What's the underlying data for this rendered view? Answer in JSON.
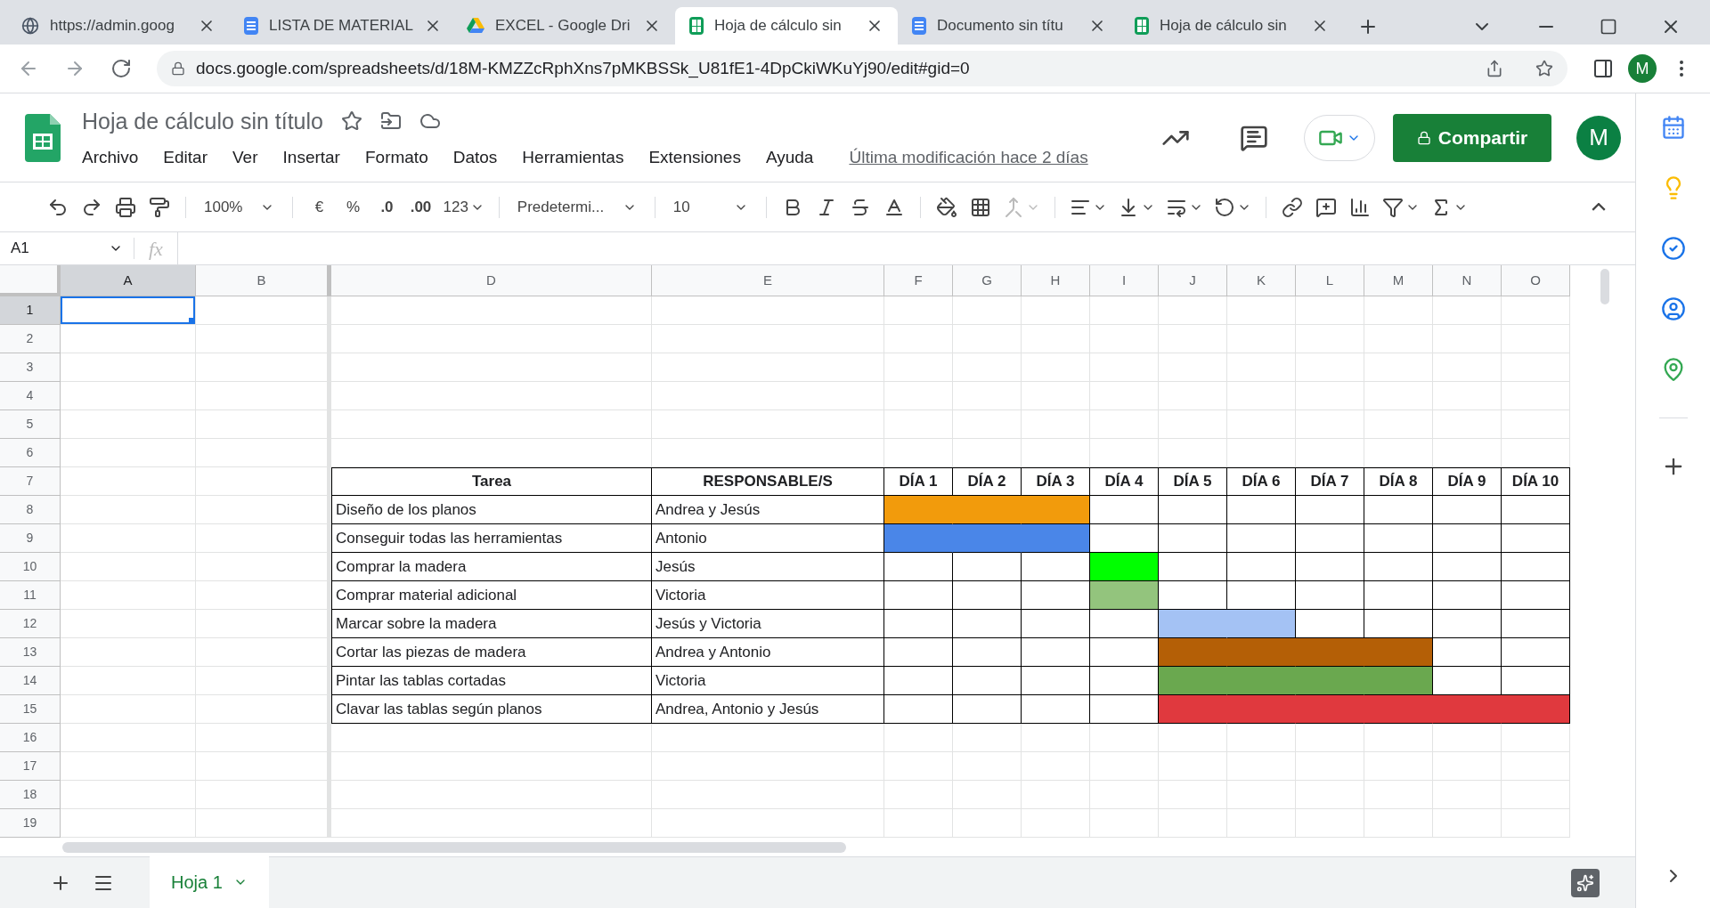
{
  "browser_tabs": [
    {
      "title": "https://admin.goog",
      "kind": "globe",
      "selected": false
    },
    {
      "title": "LISTA DE MATERIAL",
      "kind": "docs",
      "selected": false
    },
    {
      "title": "EXCEL - Google Dri",
      "kind": "drive",
      "selected": false
    },
    {
      "title": "Hoja de cálculo sin",
      "kind": "sheets",
      "selected": true
    },
    {
      "title": "Documento sin títu",
      "kind": "docs",
      "selected": false
    },
    {
      "title": "Hoja de cálculo sin",
      "kind": "sheets",
      "selected": false
    }
  ],
  "address_bar": {
    "url": "docs.google.com/spreadsheets/d/18M-KMZZcRphXns7pMKBSSk_U81fE1-4DpCkiWKuYj90/edit#gid=0",
    "profile": "M"
  },
  "document": {
    "title": "Hoja de cálculo sin título",
    "menus": [
      "Archivo",
      "Editar",
      "Ver",
      "Insertar",
      "Formato",
      "Datos",
      "Herramientas",
      "Extensiones",
      "Ayuda"
    ],
    "last_edit": "Última modificación hace 2 días",
    "share": "Compartir",
    "avatar": "M"
  },
  "toolbar": {
    "zoom": "100%",
    "currency": "€",
    "percent": "%",
    "decrease_decimals": ".0",
    "increase_decimals": ".00",
    "more_formats": "123",
    "font": "Predetermi...",
    "font_size": "10"
  },
  "formula_bar": {
    "cell": "A1",
    "fx": "fx"
  },
  "sheet": {
    "columns": [
      {
        "label": "A",
        "selected": true
      },
      {
        "label": "B",
        "selected": false
      },
      {
        "label": "D",
        "selected": false
      },
      {
        "label": "E",
        "selected": false
      },
      {
        "label": "F",
        "selected": false
      },
      {
        "label": "G",
        "selected": false
      },
      {
        "label": "H",
        "selected": false
      },
      {
        "label": "I",
        "selected": false
      },
      {
        "label": "J",
        "selected": false
      },
      {
        "label": "K",
        "selected": false
      },
      {
        "label": "L",
        "selected": false
      },
      {
        "label": "M",
        "selected": false
      },
      {
        "label": "N",
        "selected": false
      },
      {
        "label": "O",
        "selected": false
      }
    ],
    "rows": [
      {
        "label": "1",
        "selected": true
      },
      {
        "label": "2",
        "selected": false
      },
      {
        "label": "3",
        "selected": false
      },
      {
        "label": "4",
        "selected": false
      },
      {
        "label": "5",
        "selected": false
      },
      {
        "label": "6",
        "selected": false
      },
      {
        "label": "7",
        "selected": false
      },
      {
        "label": "8",
        "selected": false
      },
      {
        "label": "9",
        "selected": false
      },
      {
        "label": "10",
        "selected": false
      },
      {
        "label": "11",
        "selected": false
      },
      {
        "label": "12",
        "selected": false
      },
      {
        "label": "13",
        "selected": false
      },
      {
        "label": "14",
        "selected": false
      },
      {
        "label": "15",
        "selected": false
      },
      {
        "label": "16",
        "selected": false
      },
      {
        "label": "17",
        "selected": false
      },
      {
        "label": "18",
        "selected": false
      },
      {
        "label": "19",
        "selected": false
      }
    ]
  },
  "gantt": {
    "header": {
      "task": "Tarea",
      "responsible": "RESPONSABLE/S",
      "days": [
        "DÍA 1",
        "DÍA 2",
        "DÍA 3",
        "DÍA 4",
        "DÍA 5",
        "DÍA 6",
        "DÍA 7",
        "DÍA 8",
        "DÍA 9",
        "DÍA 10"
      ]
    },
    "tasks": [
      {
        "task": "Diseño de los planos",
        "responsible": "Andrea y Jesús",
        "color": "#f29b0c",
        "days": [
          true,
          true,
          true,
          false,
          false,
          false,
          false,
          false,
          false,
          false
        ]
      },
      {
        "task": "Conseguir todas las herramientas",
        "responsible": "Antonio",
        "color": "#4a86e8",
        "days": [
          true,
          true,
          true,
          false,
          false,
          false,
          false,
          false,
          false,
          false
        ]
      },
      {
        "task": "Comprar la madera",
        "responsible": "Jesús",
        "color": "#00ff00",
        "days": [
          false,
          false,
          false,
          true,
          false,
          false,
          false,
          false,
          false,
          false
        ]
      },
      {
        "task": "Comprar material adicional",
        "responsible": "Victoria",
        "color": "#93c47d",
        "days": [
          false,
          false,
          false,
          true,
          false,
          false,
          false,
          false,
          false,
          false
        ]
      },
      {
        "task": "Marcar sobre la madera",
        "responsible": "Jesús y Victoria",
        "color": "#a4c2f4",
        "days": [
          false,
          false,
          false,
          false,
          true,
          true,
          false,
          false,
          false,
          false
        ]
      },
      {
        "task": "Cortar las piezas de madera",
        "responsible": "Andrea y Antonio",
        "color": "#b45f06",
        "days": [
          false,
          false,
          false,
          false,
          true,
          true,
          true,
          true,
          false,
          false
        ]
      },
      {
        "task": "Pintar las tablas cortadas",
        "responsible": "Victoria",
        "color": "#6aa84f",
        "days": [
          false,
          false,
          false,
          false,
          true,
          true,
          true,
          true,
          false,
          false
        ]
      },
      {
        "task": "Clavar las tablas según planos",
        "responsible": "Andrea, Antonio y Jesús",
        "color": "#e0393e",
        "days": [
          false,
          false,
          false,
          false,
          true,
          true,
          true,
          true,
          true,
          true
        ]
      }
    ]
  },
  "sheet_tabs": [
    {
      "label": "Hoja 1",
      "selected": true
    }
  ]
}
